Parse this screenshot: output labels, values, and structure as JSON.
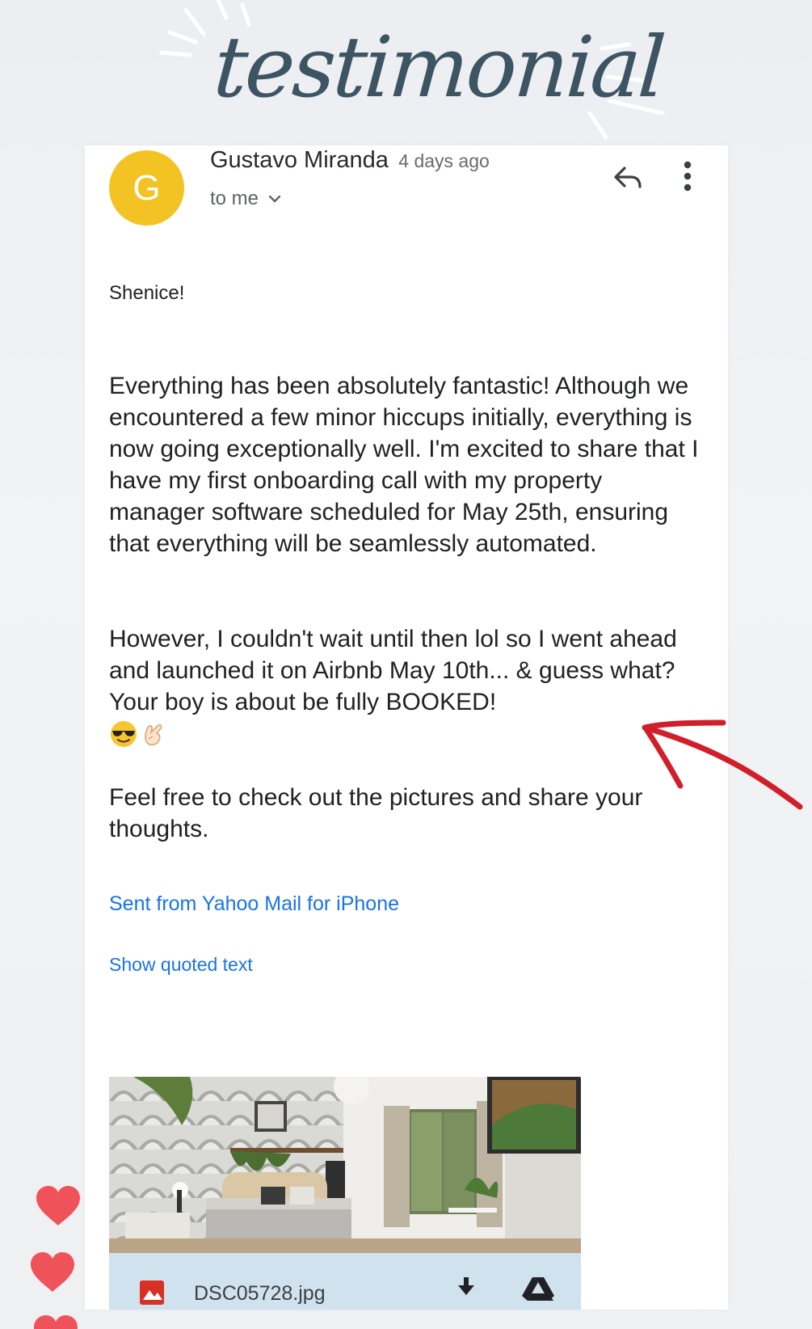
{
  "title": "testimonial",
  "email": {
    "avatar_letter": "G",
    "sender_name": "Gustavo Miranda",
    "time": "4 days ago",
    "recipient": "to me",
    "greeting": "Shenice!",
    "paragraphs": [
      "Everything has been absolutely fantastic! Although we encountered a few minor hiccups initially, everything is now going exceptionally well. I'm excited to share that I have my first onboarding call with my property manager software scheduled for May 25th, ensuring that everything will be seamlessly automated.",
      "However, I couldn't wait until then lol so I went ahead and launched it on Airbnb May 10th... & guess what? Your boy is about be fully BOOKED!",
      "Feel free to check out the pictures and share your thoughts."
    ],
    "emojis": [
      "😎",
      "🤙"
    ],
    "sent_from": "Sent from Yahoo Mail for iPhone",
    "show_quoted": "Show quoted text",
    "attachment": {
      "file_name": "DSC05728.jpg"
    }
  },
  "icons": {
    "reply": "reply-icon",
    "more": "more-vert-icon",
    "chevron": "chevron-down-icon",
    "file": "image-file-icon",
    "download": "download-icon",
    "drive": "drive-icon",
    "heart": "heart-icon"
  },
  "colors": {
    "avatar": "#f3c324",
    "link": "#1a73e8",
    "arrow": "#d11f2a",
    "heart": "#f0525a",
    "title": "#3d5563"
  }
}
